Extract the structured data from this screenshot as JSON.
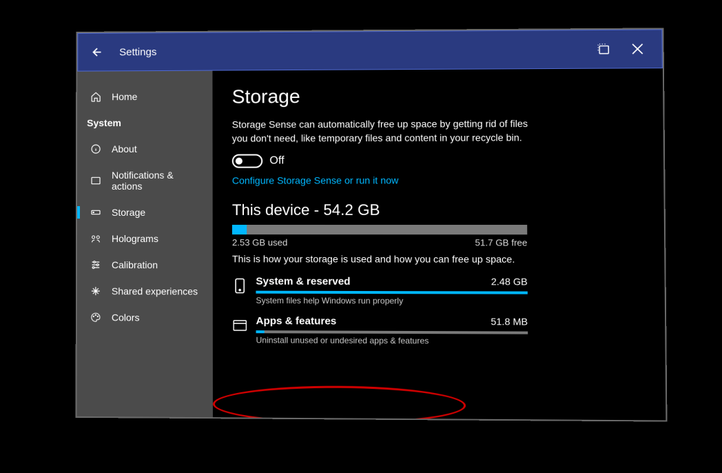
{
  "header": {
    "title": "Settings"
  },
  "sidebar": {
    "items": [
      {
        "label": "Home",
        "icon": "home-icon",
        "type": "item"
      },
      {
        "label": "System",
        "icon": "",
        "type": "group"
      },
      {
        "label": "About",
        "icon": "info-icon",
        "type": "item"
      },
      {
        "label": "Notifications & actions",
        "icon": "notification-icon",
        "type": "item"
      },
      {
        "label": "Storage",
        "icon": "storage-icon",
        "type": "item",
        "active": true
      },
      {
        "label": "Holograms",
        "icon": "holograms-icon",
        "type": "item"
      },
      {
        "label": "Calibration",
        "icon": "sliders-icon",
        "type": "item"
      },
      {
        "label": "Shared experiences",
        "icon": "shared-icon",
        "type": "item"
      },
      {
        "label": "Colors",
        "icon": "palette-icon",
        "type": "item"
      }
    ]
  },
  "main": {
    "title": "Storage",
    "description": "Storage Sense can automatically free up space by getting rid of files you don't need, like temporary files and content in your recycle bin.",
    "toggle_label": "Off",
    "configure_link": "Configure Storage Sense or run it now",
    "device_section_title": "This device - 54.2 GB",
    "used_label": "2.53 GB used",
    "free_label": "51.7 GB free",
    "used_percent": 5,
    "breakdown_intro": "This is how your storage is used and how you can free up space.",
    "categories": [
      {
        "name": "System & reserved",
        "size": "2.48 GB",
        "description": "System files help Windows run properly",
        "percent": 100,
        "icon": "device-icon"
      },
      {
        "name": "Apps & features",
        "size": "51.8 MB",
        "description": "Uninstall unused or undesired apps & features",
        "percent": 3,
        "icon": "apps-icon"
      }
    ]
  }
}
